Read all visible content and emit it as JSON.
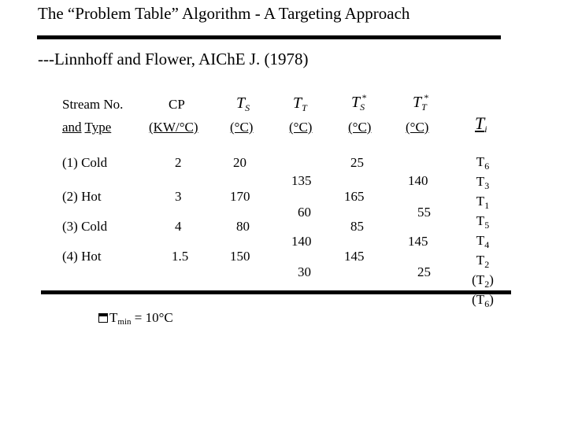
{
  "slide": {
    "title": "The “Problem Table” Algorithm - A Targeting Approach",
    "subtitle": "---Linnhoff and Flower, AIChE J. (1978)"
  },
  "table": {
    "headers": {
      "stream": {
        "line1": "Stream No.",
        "line2a": "and",
        "line2b": "Type"
      },
      "cp": {
        "line1": "CP",
        "line2": "(KW/°C)"
      },
      "ts": {
        "symbol": "T",
        "sub": "S",
        "sup": "",
        "unit": "(°C)"
      },
      "tt": {
        "symbol": "T",
        "sub": "T",
        "sup": "",
        "unit": "(°C)"
      },
      "ts_star": {
        "symbol": "T",
        "sub": "S",
        "sup": "*",
        "unit": "(°C)"
      },
      "tt_star": {
        "symbol": "T",
        "sub": "T",
        "sup": "*",
        "unit": "(°C)"
      },
      "ti": {
        "symbol": "T",
        "sub": "i"
      }
    },
    "rows": [
      {
        "stream": "(1) Cold",
        "cp": "2",
        "ts": "20",
        "tt": "135",
        "ts_star": "25",
        "tt_star": "140"
      },
      {
        "stream": "(2) Hot",
        "cp": "3",
        "ts": "170",
        "tt": "60",
        "ts_star": "165",
        "tt_star": "55"
      },
      {
        "stream": "(3) Cold",
        "cp": "4",
        "ts": "80",
        "tt": "140",
        "ts_star": "85",
        "tt_star": "145"
      },
      {
        "stream": "(4) Hot",
        "cp": "1.5",
        "ts": "150",
        "tt": "30",
        "ts_star": "145",
        "tt_star": "25"
      }
    ],
    "ti_column": [
      {
        "prefix": "",
        "symbol": "T",
        "sub": "6",
        "suffix": ""
      },
      {
        "prefix": "",
        "symbol": "T",
        "sub": "3",
        "suffix": ""
      },
      {
        "prefix": "",
        "symbol": "T",
        "sub": "1",
        "suffix": ""
      },
      {
        "prefix": "",
        "symbol": "T",
        "sub": "5",
        "suffix": ""
      },
      {
        "prefix": "",
        "symbol": "T",
        "sub": "4",
        "suffix": ""
      },
      {
        "prefix": "",
        "symbol": "T",
        "sub": "2",
        "suffix": ""
      },
      {
        "prefix": "(",
        "symbol": "T",
        "sub": "2",
        "suffix": ")"
      },
      {
        "prefix": "(",
        "symbol": "T",
        "sub": "6",
        "suffix": ")"
      }
    ]
  },
  "note": {
    "icon": "delta-box-icon",
    "symbol": "T",
    "sub": "min",
    "text": " = 10°C"
  }
}
